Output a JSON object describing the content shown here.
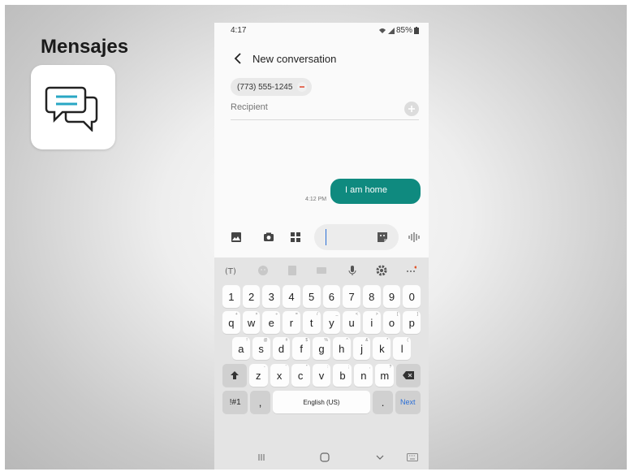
{
  "slide": {
    "title": "Mensajes",
    "app_icon": "chat-bubbles-icon"
  },
  "status_bar": {
    "time": "4:17",
    "battery": "85%",
    "icons": [
      "wifi-icon",
      "signal-icon",
      "battery-icon"
    ]
  },
  "header": {
    "back_icon": "chevron-left-icon",
    "title": "New conversation"
  },
  "recipient": {
    "chip_number": "(773) 555-1245",
    "chip_remove_icon": "minus-icon",
    "placeholder": "Recipient",
    "add_icon": "plus-icon"
  },
  "messages": [
    {
      "text": "I am home",
      "time": "4:12 PM",
      "direction": "sent"
    }
  ],
  "compose": {
    "icons": [
      "image-icon",
      "camera-icon",
      "grid-icon"
    ],
    "sticker_icon": "sticker-icon",
    "voice_icon": "voice-waveform-icon"
  },
  "keyboard": {
    "toolbar": [
      "text-prediction-icon",
      "emoji-icon",
      "sticker-icon",
      "clipboard-icon",
      "mic-icon",
      "gear-icon",
      "more-icon"
    ],
    "number_row": [
      "1",
      "2",
      "3",
      "4",
      "5",
      "6",
      "7",
      "8",
      "9",
      "0"
    ],
    "row1": [
      "q",
      "w",
      "e",
      "r",
      "t",
      "y",
      "u",
      "i",
      "o",
      "p"
    ],
    "row1_hints": [
      "+",
      "×",
      "÷",
      "=",
      "/",
      "_",
      "<",
      ">",
      "[",
      "]"
    ],
    "row2": [
      "a",
      "s",
      "d",
      "f",
      "g",
      "h",
      "j",
      "k",
      "l"
    ],
    "row2_hints": [
      "!",
      "@",
      "#",
      "$",
      "%",
      "^",
      "&",
      "*",
      "("
    ],
    "row3": [
      "z",
      "x",
      "c",
      "v",
      "b",
      "n",
      "m"
    ],
    "row3_hints": [
      "-",
      "'",
      "\"",
      ":",
      ";",
      ",",
      "?"
    ],
    "symbols_key": "!#1",
    "comma_key": ",",
    "space_label": "English (US)",
    "period_key": ".",
    "next_key": "Next",
    "accent": "#2b6fd6"
  },
  "nav_bar": [
    "recents-icon",
    "home-icon",
    "back-chevron-icon",
    "keyboard-icon"
  ],
  "colors": {
    "bubble": "#0f8a7f",
    "accent": "#2b6fd6",
    "icon_teal": "#29a7c4"
  }
}
